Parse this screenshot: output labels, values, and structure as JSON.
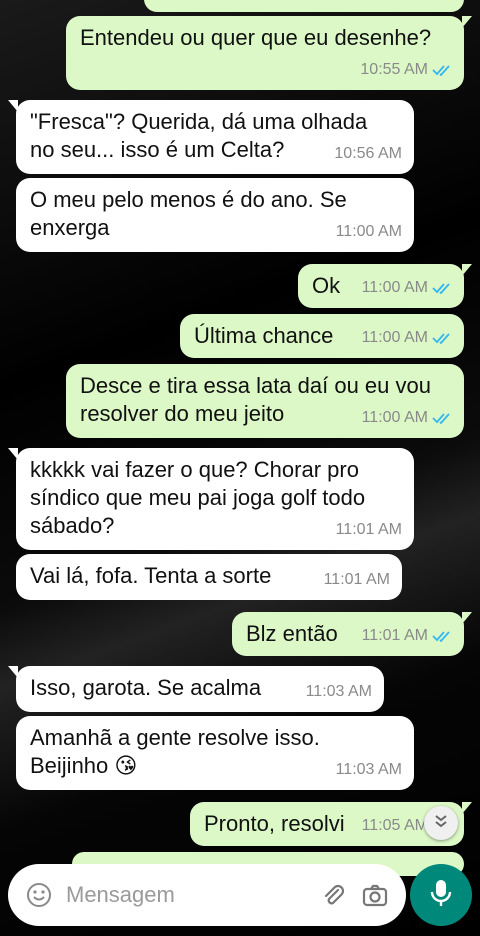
{
  "messages": [
    {
      "dir": "out",
      "text": "Entendeu ou quer que eu desenhe?",
      "time": "10:55 AM"
    },
    {
      "dir": "in",
      "text": "\"Fresca\"? Querida, dá uma olhada\nno seu... isso é um Celta?",
      "time": "10:56 AM"
    },
    {
      "dir": "in",
      "text": "O meu pelo menos é do ano. Se\nenxerga",
      "time": "11:00 AM"
    },
    {
      "dir": "out",
      "text": "Ok",
      "time": "11:00 AM"
    },
    {
      "dir": "out",
      "text": "Última chance",
      "time": "11:00 AM"
    },
    {
      "dir": "out",
      "text": "Desce e tira essa lata daí ou eu vou\nresolver do meu jeito",
      "time": "11:00 AM"
    },
    {
      "dir": "in",
      "text": "kkkkk vai fazer o que? Chorar pro\nsíndico que meu pai joga golf todo\nsábado?",
      "time": "11:01 AM"
    },
    {
      "dir": "in",
      "text": "Vai lá, fofa. Tenta a sorte",
      "time": "11:01 AM"
    },
    {
      "dir": "out",
      "text": "Blz então",
      "time": "11:01 AM"
    },
    {
      "dir": "in",
      "text": "Isso, garota. Se acalma",
      "time": "11:03 AM"
    },
    {
      "dir": "in",
      "text": "Amanhã a gente resolve isso.\nBeijinho 😘",
      "time": "11:03 AM"
    },
    {
      "dir": "out",
      "text": "Pronto, resolvi",
      "time": "11:05 AM"
    }
  ],
  "composer": {
    "placeholder": "Mensagem"
  },
  "colors": {
    "outgoing": "#dcf8c6",
    "incoming": "#ffffff",
    "read_ticks": "#34b7f1",
    "mic_button": "#00897b"
  },
  "icons": {
    "emoji": "emoji-icon",
    "attach": "paperclip-icon",
    "camera": "camera-icon",
    "mic": "mic-icon",
    "scroll": "double-chevron-down-icon",
    "read": "double-check-icon"
  }
}
